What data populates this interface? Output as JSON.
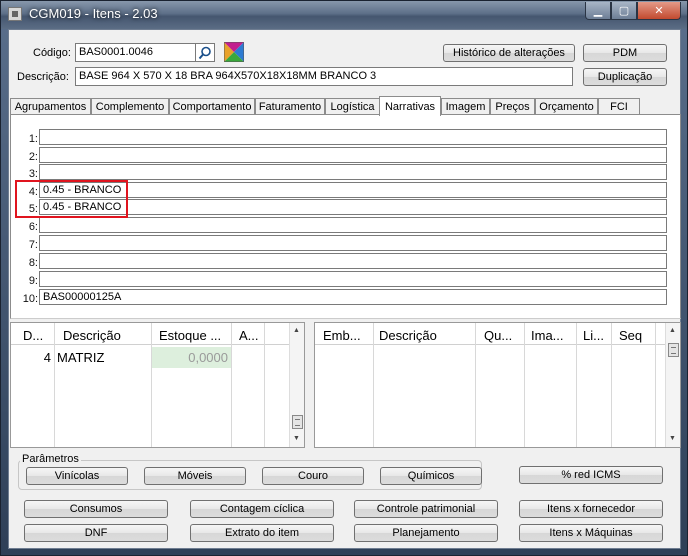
{
  "window": {
    "title": "CGM019 - Itens - 2.03"
  },
  "header": {
    "codigo_label": "Código:",
    "codigo_value": "BAS0001.0046",
    "descricao_label": "Descrição:",
    "descricao_value": "BASE 964 X 570 X 18 BRA 964X570X18X18MM BRANCO 3",
    "historico_button": "Histórico de alterações",
    "pdm_button": "PDM",
    "duplicacao_button": "Duplicação"
  },
  "tabs": [
    {
      "label": "Agrupamentos"
    },
    {
      "label": "Complemento"
    },
    {
      "label": "Comportamento"
    },
    {
      "label": "Faturamento"
    },
    {
      "label": "Logística"
    },
    {
      "label": "Narrativas"
    },
    {
      "label": "Imagem"
    },
    {
      "label": "Preços"
    },
    {
      "label": "Orçamento"
    },
    {
      "label": "FCI"
    }
  ],
  "narrativas": [
    {
      "num": "1:",
      "value": ""
    },
    {
      "num": "2:",
      "value": ""
    },
    {
      "num": "3:",
      "value": ""
    },
    {
      "num": "4:",
      "value": "0.45 - BRANCO"
    },
    {
      "num": "5:",
      "value": "0.45 - BRANCO"
    },
    {
      "num": "6:",
      "value": ""
    },
    {
      "num": "7:",
      "value": ""
    },
    {
      "num": "8:",
      "value": ""
    },
    {
      "num": "9:",
      "value": ""
    },
    {
      "num": "10:",
      "value": "BAS00000125A"
    }
  ],
  "left_grid": {
    "headers": [
      "D...",
      "Descrição",
      "Estoque ...",
      "A..."
    ],
    "row": {
      "d": "4",
      "descricao": "MATRIZ",
      "estoque": "0,0000",
      "a": ""
    }
  },
  "right_grid": {
    "headers": [
      "Emb...",
      "Descrição",
      "Qu...",
      "Ima...",
      "Li...",
      "Seq"
    ]
  },
  "parametros": {
    "label": "Parâmetros",
    "buttons": [
      "Vinícolas",
      "Móveis",
      "Couro",
      "Químicos"
    ]
  },
  "red_icms_button": "% red ICMS",
  "bottom_buttons": {
    "row1": [
      "Consumos",
      "Contagem cíclica",
      "Controle patrimonial",
      "Itens x fornecedor"
    ],
    "row2": [
      "DNF",
      "Extrato do item",
      "Planejamento",
      "Itens x Máquinas"
    ]
  },
  "colors": {
    "highlight": "#e0141e",
    "active_tab": "#ffffff"
  }
}
